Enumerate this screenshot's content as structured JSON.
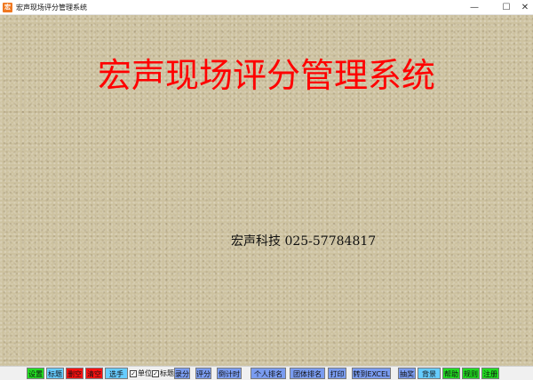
{
  "window": {
    "icon_glyph": "宏",
    "title": "宏声现场评分管理系统",
    "minimize_glyph": "—",
    "maximize_glyph": "☐",
    "close_glyph": "✕"
  },
  "main": {
    "title": "宏声现场评分管理系统",
    "company": "宏声科技 025-57784817",
    "title_color": "#ff0000",
    "background_color": "#cdc2a0"
  },
  "toolbar": {
    "buttons": [
      {
        "label": "设置",
        "color": "#22dd22"
      },
      {
        "label": "标题",
        "color": "#66ccff"
      },
      {
        "label": "删空",
        "color": "#ff1111"
      },
      {
        "label": "清空",
        "color": "#ff1111"
      },
      {
        "label": "选手",
        "color": "#66ccff"
      },
      {
        "label": "录分",
        "color": "#7a9cf0"
      },
      {
        "label": "评分",
        "color": "#7a9cf0"
      },
      {
        "label": "倒计时",
        "color": "#7a9cf0"
      },
      {
        "label": "个人排名",
        "color": "#7a9cf0"
      },
      {
        "label": "团体排名",
        "color": "#7a9cf0"
      },
      {
        "label": "打印",
        "color": "#7a9cf0"
      },
      {
        "label": "转到EXCEL",
        "color": "#7a9cf0"
      },
      {
        "label": "抽奖",
        "color": "#7a9cf0"
      },
      {
        "label": "背景",
        "color": "#66ccff"
      },
      {
        "label": "帮助",
        "color": "#22dd22"
      },
      {
        "label": "规则",
        "color": "#22dd22"
      },
      {
        "label": "注册",
        "color": "#22dd22"
      }
    ],
    "checkboxes": [
      {
        "label": "单位",
        "checked_glyph": "✓"
      },
      {
        "label": "标题",
        "checked_glyph": "✓"
      }
    ]
  }
}
